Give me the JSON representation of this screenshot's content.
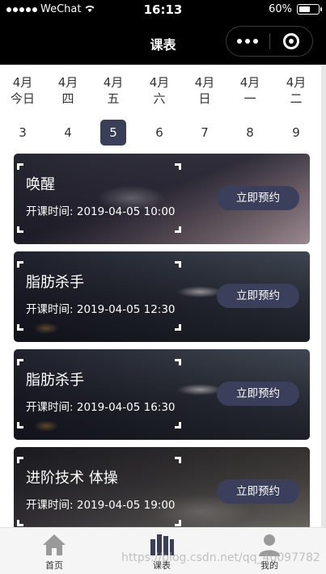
{
  "status_bar": {
    "carrier": "WeChat",
    "time": "16:13",
    "battery": "60%",
    "battery_level": 0.6
  },
  "nav": {
    "title": "课表"
  },
  "dates": [
    {
      "month": "4月",
      "weekday": "今日",
      "day": "3",
      "active": false
    },
    {
      "month": "4月",
      "weekday": "四",
      "day": "4",
      "active": false
    },
    {
      "month": "4月",
      "weekday": "五",
      "day": "5",
      "active": true
    },
    {
      "month": "4月",
      "weekday": "六",
      "day": "6",
      "active": false
    },
    {
      "month": "4月",
      "weekday": "日",
      "day": "7",
      "active": false
    },
    {
      "month": "4月",
      "weekday": "一",
      "day": "8",
      "active": false
    },
    {
      "month": "4月",
      "weekday": "二",
      "day": "9",
      "active": false
    }
  ],
  "classes": [
    {
      "name": "唤醒",
      "start_label": "开课时间:",
      "start_time": "2019-04-05 10:00",
      "button": "立即预约"
    },
    {
      "name": "脂肪杀手",
      "start_label": "开课时间:",
      "start_time": "2019-04-05 12:30",
      "button": "立即预约"
    },
    {
      "name": "脂肪杀手",
      "start_label": "开课时间:",
      "start_time": "2019-04-05 16:30",
      "button": "立即预约"
    },
    {
      "name": "进阶技术 体操",
      "start_label": "开课时间:",
      "start_time": "2019-04-05 19:00",
      "button": "立即预约"
    }
  ],
  "tabs": [
    {
      "label": "首页",
      "icon": "home-icon"
    },
    {
      "label": "课表",
      "icon": "schedule-icon"
    },
    {
      "label": "我的",
      "icon": "profile-icon"
    }
  ],
  "watermark": "https://blog.csdn.net/qq_40097782",
  "colors": {
    "accent": "#3a3f58",
    "button": "#3c3f5b",
    "topbar": "#000000"
  }
}
